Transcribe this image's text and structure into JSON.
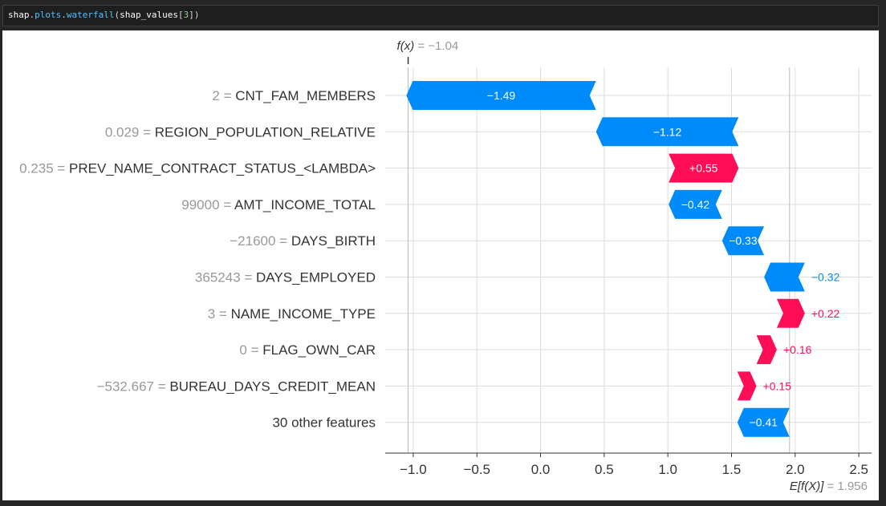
{
  "code": {
    "var": "shap",
    "dot1": ".",
    "attr1": "plots",
    "dot2": ".",
    "attr2": "waterfall",
    "paren_open": "(",
    "arg": "shap_values",
    "bracket_open": "[",
    "index": "3",
    "bracket_close": "]",
    "paren_close": ")"
  },
  "colors": {
    "positive": "#ff0d57",
    "negative": "#008bfb",
    "grid": "#dddddd",
    "value_gray": "#999999",
    "label": "#333333"
  },
  "chart_data": {
    "type": "waterfall",
    "fx_label": "f(x)",
    "fx_value": "= −1.04",
    "fx": -1.04,
    "ex_label": "E[f(X)]",
    "ex_value": "= 1.956",
    "ex": 1.956,
    "xlim": [
      -1.22,
      2.6
    ],
    "xticks": [
      -1.0,
      -0.5,
      0.0,
      0.5,
      1.0,
      1.5,
      2.0,
      2.5
    ],
    "xtick_labels": [
      "−1.0",
      "−0.5",
      "0.0",
      "0.5",
      "1.0",
      "1.5",
      "2.0",
      "2.5"
    ],
    "features": [
      {
        "value": "2",
        "name": "CNT_FAM_MEMBERS",
        "shap": -1.49,
        "label": "−1.49"
      },
      {
        "value": "0.029",
        "name": "REGION_POPULATION_RELATIVE",
        "shap": -1.12,
        "label": "−1.12"
      },
      {
        "value": "0.235",
        "name": "PREV_NAME_CONTRACT_STATUS_<LAMBDA>",
        "shap": 0.55,
        "label": "+0.55"
      },
      {
        "value": "99000",
        "name": "AMT_INCOME_TOTAL",
        "shap": -0.42,
        "label": "−0.42"
      },
      {
        "value": "−21600",
        "name": "DAYS_BIRTH",
        "shap": -0.33,
        "label": "−0.33"
      },
      {
        "value": "365243",
        "name": "DAYS_EMPLOYED",
        "shap": -0.32,
        "label": "−0.32"
      },
      {
        "value": "3",
        "name": "NAME_INCOME_TYPE",
        "shap": 0.22,
        "label": "+0.22"
      },
      {
        "value": "0",
        "name": "FLAG_OWN_CAR",
        "shap": 0.16,
        "label": "+0.16"
      },
      {
        "value": "−532.667",
        "name": "BUREAU_DAYS_CREDIT_MEAN",
        "shap": 0.15,
        "label": "+0.15"
      },
      {
        "value": "",
        "name": "30 other features",
        "shap": -0.41,
        "label": "−0.41"
      }
    ]
  }
}
